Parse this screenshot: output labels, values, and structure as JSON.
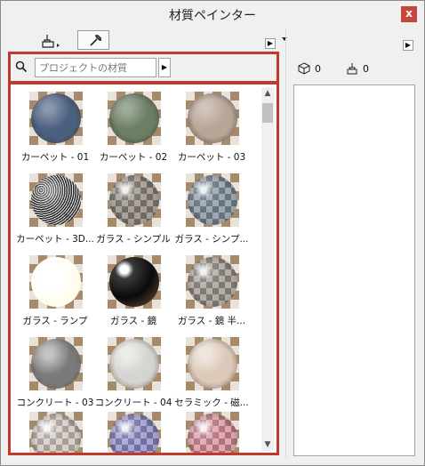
{
  "window": {
    "title": "材質ペインター",
    "close_label": "x"
  },
  "search": {
    "placeholder": "プロジェクトの材質",
    "value": "プロジェクトの材質"
  },
  "materials": [
    {
      "label": "カーペット - 01",
      "color": "#4b5f80",
      "pattern": "noise"
    },
    {
      "label": "カーペット - 02",
      "color": "#6c7e63",
      "pattern": "noise"
    },
    {
      "label": "カーペット - 03",
      "color": "#b7a596",
      "pattern": "noise"
    },
    {
      "label": "カーペット - 3D...",
      "color": "#6e6e6e",
      "pattern": "speckle"
    },
    {
      "label": "ガラス - シンプル",
      "color": "#8a8278",
      "pattern": "glass"
    },
    {
      "label": "ガラス - シンプ...",
      "color": "#7c8b9a",
      "pattern": "glass"
    },
    {
      "label": "ガラス - ランプ",
      "color": "#fffbe6",
      "pattern": "lamp"
    },
    {
      "label": "ガラス - 鏡",
      "color": "#0f0f0f",
      "pattern": "mirror"
    },
    {
      "label": "ガラス - 鏡 半...",
      "color": "#9a938a",
      "pattern": "glass"
    },
    {
      "label": "コンクリート - 03",
      "color": "#7a7a7a",
      "pattern": "matte"
    },
    {
      "label": "コンクリート - 04",
      "color": "#d6d4d0",
      "pattern": "matte"
    },
    {
      "label": "セラミック - 磁...",
      "color": "#dcc9b8",
      "pattern": "matte"
    },
    {
      "label": "",
      "color": "#c9c1b8",
      "pattern": "glass"
    },
    {
      "label": "",
      "color": "#8a88c4",
      "pattern": "glass"
    },
    {
      "label": "",
      "color": "#d68a96",
      "pattern": "glass"
    }
  ],
  "right_panel": {
    "surface_count": "0",
    "brush_count": "0"
  }
}
